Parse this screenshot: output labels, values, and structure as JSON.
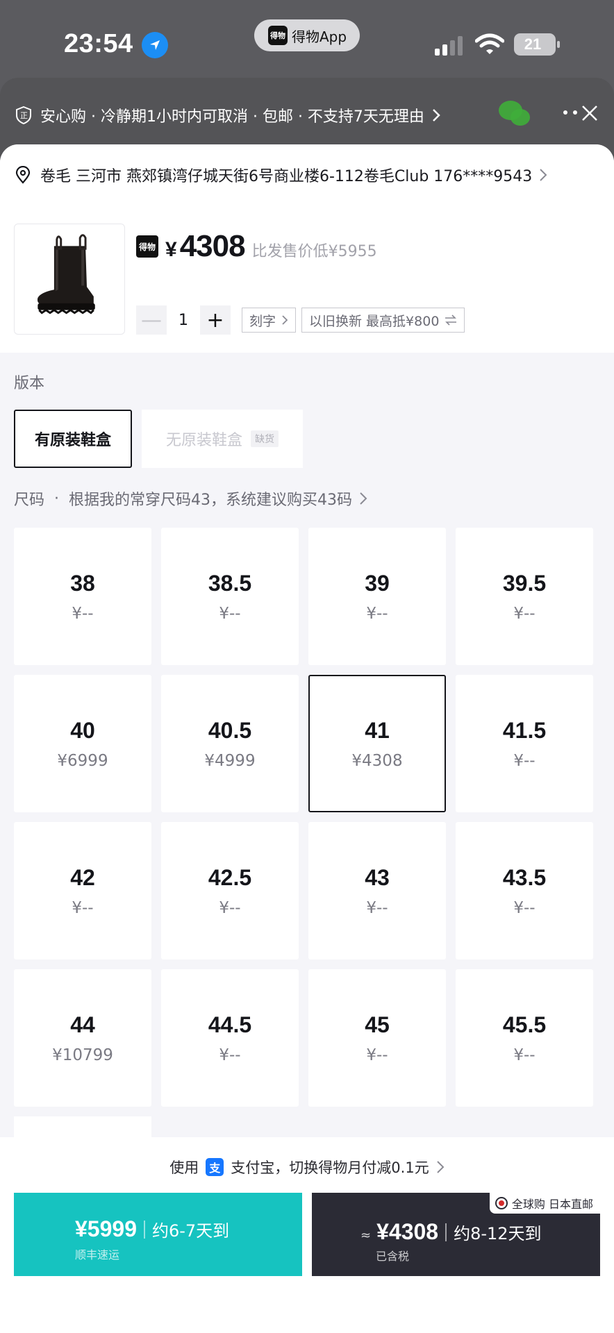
{
  "status_bar": {
    "time": "23:54",
    "app_name": "得物App",
    "app_logo_text": "得物",
    "battery": "21"
  },
  "header": {
    "guarantee_text": "安心购 · 冷静期1小时内可取消 · 包邮 · 不支持7天无理由"
  },
  "address": {
    "text": "卷毛 三河市 燕郊镇湾仔城天街6号商业楼6-112卷毛Club 176****9543"
  },
  "product": {
    "logo_text": "得物",
    "currency": "¥",
    "price": "4308",
    "compare_text": "比发售价低¥5955",
    "quantity": "1",
    "minus": "—",
    "plus": "+",
    "engrave_label": "刻字",
    "trade_in_label": "以旧换新 最高抵¥800"
  },
  "version": {
    "label": "版本",
    "options": [
      {
        "label": "有原装鞋盒",
        "selected": true
      },
      {
        "label": "无原装鞋盒",
        "tag": "缺货",
        "disabled": true
      }
    ]
  },
  "size_section": {
    "label": "尺码",
    "dot": "·",
    "hint": "根据我的常穿尺码43，系统建议购买43码"
  },
  "sizes": [
    {
      "size": "38",
      "price": "¥--"
    },
    {
      "size": "38.5",
      "price": "¥--"
    },
    {
      "size": "39",
      "price": "¥--"
    },
    {
      "size": "39.5",
      "price": "¥--"
    },
    {
      "size": "40",
      "price": "¥6999"
    },
    {
      "size": "40.5",
      "price": "¥4999"
    },
    {
      "size": "41",
      "price": "¥4308",
      "selected": true
    },
    {
      "size": "41.5",
      "price": "¥--"
    },
    {
      "size": "42",
      "price": "¥--"
    },
    {
      "size": "42.5",
      "price": "¥--"
    },
    {
      "size": "43",
      "price": "¥--"
    },
    {
      "size": "43.5",
      "price": "¥--"
    },
    {
      "size": "44",
      "price": "¥10799"
    },
    {
      "size": "44.5",
      "price": "¥--"
    },
    {
      "size": "45",
      "price": "¥--"
    },
    {
      "size": "45.5",
      "price": "¥--"
    }
  ],
  "bottom": {
    "pay_prefix": "使用",
    "alipay_icon": "支",
    "pay_text": "支付宝，切换得物月付减0.1元",
    "left_button": {
      "price": "¥5999",
      "delivery": "约6-7天到",
      "sub": "顺丰速运"
    },
    "right_button": {
      "approx": "≈",
      "price": "¥4308",
      "delivery": "约8-12天到",
      "sub": "已含税",
      "badge": "全球购 日本直邮"
    }
  },
  "colors": {
    "accent_teal": "#16c3c0",
    "dark_button": "#2b2b35",
    "text_primary": "#14151a"
  }
}
